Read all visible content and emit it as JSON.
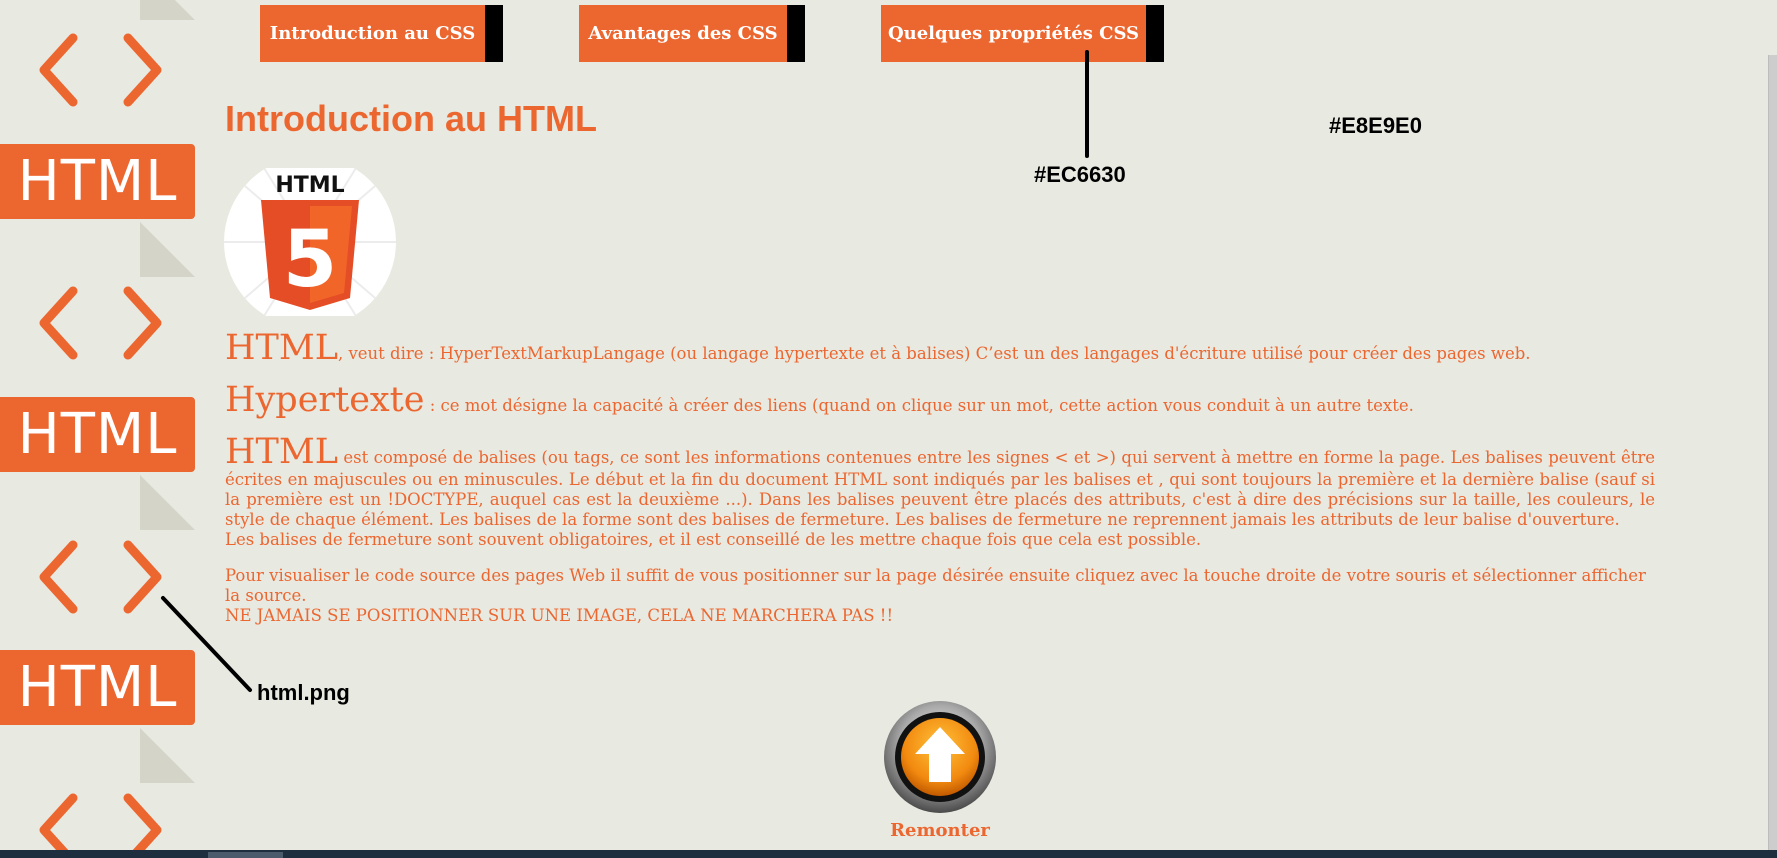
{
  "colors": {
    "background": "#E8E9E0",
    "accent": "#EC6630",
    "nav_stripe": "#000000",
    "text_on_accent": "#FFFFFF"
  },
  "sidebar": {
    "banner_label": "HTML",
    "icons": [
      "chevron-pair-icon",
      "html-banner",
      "page-fold"
    ]
  },
  "nav": {
    "items": [
      {
        "label": "Introduction au CSS"
      },
      {
        "label": "Avantages des CSS"
      },
      {
        "label": "Quelques propriétés CSS"
      }
    ]
  },
  "annotations": {
    "nav_color": "#EC6630",
    "background_color": "#E8E9E0",
    "sidebar_image": "html.png"
  },
  "main": {
    "title": "Introduction au HTML",
    "logo_text": "HTML",
    "logo_number": "5",
    "paragraphs": {
      "p1_term": "HTML",
      "p1_text": ", veut dire : HyperTextMarkupLangage (ou langage hypertexte et à balises) C’est un des langages d'écriture utilisé pour créer des pages web.",
      "p2_term": "Hypertexte",
      "p2_text": " : ce mot désigne la capacité à créer des liens (quand on clique sur un mot, cette action vous conduit à un autre texte.",
      "p3_term": "HTML",
      "p3_text": " est composé de balises (ou tags, ce sont les informations contenues entre les signes < et >) qui servent à mettre en forme la page. Les balises peuvent être écrites en majuscules ou en minuscules. Le début et la fin du document HTML sont indiqués par les balises et , qui sont toujours la première et la dernière balise (sauf si la première est un !DOCTYPE, auquel cas est la deuxième ...). Dans les balises peuvent être placés des attributs, c'est à dire des précisions sur la taille, les couleurs, le style de chaque élément. Les balises de la forme sont des balises de fermeture. Les balises de fermeture ne reprennent jamais les attributs de leur balise d'ouverture.",
      "p3_line2": "Les balises de fermeture sont souvent obligatoires, et il est conseillé de les mettre chaque fois que cela est possible.",
      "p4_line1": "Pour visualiser le code source des pages Web il suffit de vous positionner sur la page désirée ensuite cliquez avec la touche droite de votre souris et sélectionner afficher la source.",
      "p4_line2": "NE JAMAIS SE POSITIONNER SUR UNE IMAGE, CELA NE MARCHERA PAS !!"
    }
  },
  "back_to_top": {
    "label": "Remonter",
    "icon": "arrow-up-icon"
  }
}
